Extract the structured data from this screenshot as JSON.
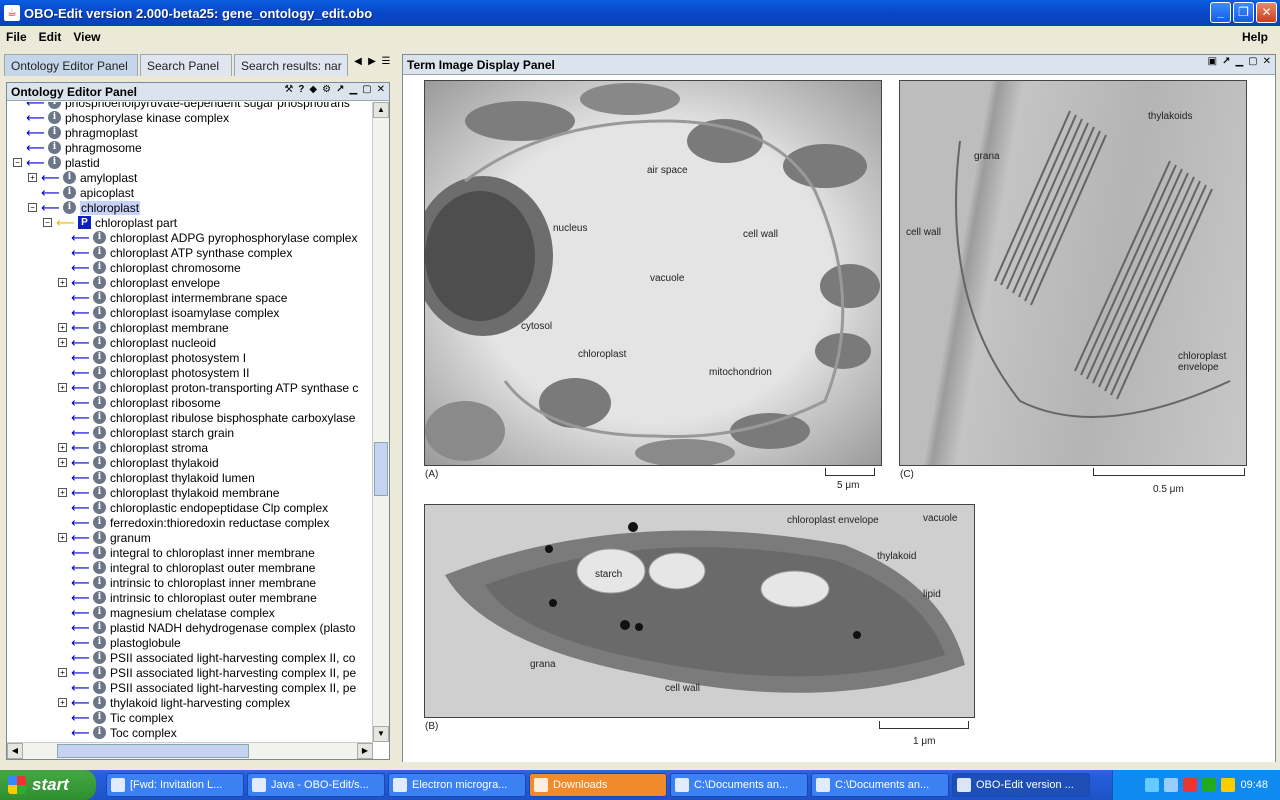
{
  "window": {
    "title": "OBO-Edit version 2.000-beta25: gene_ontology_edit.obo"
  },
  "menu": {
    "file": "File",
    "edit": "Edit",
    "view": "View",
    "help": "Help"
  },
  "left_tabs": [
    "Ontology Editor Panel",
    "Search Panel",
    "Search results: nar"
  ],
  "ontology_panel": {
    "title": "Ontology Editor Panel",
    "tree": [
      {
        "label": "phosphoenolpyruvate-dependent sugar phosphotrans",
        "depth": 1,
        "expander": "",
        "rel": "is_a",
        "badge": "i"
      },
      {
        "label": "phosphorylase kinase complex",
        "depth": 1,
        "expander": "",
        "rel": "is_a",
        "badge": "i"
      },
      {
        "label": "phragmoplast",
        "depth": 1,
        "expander": "",
        "rel": "is_a",
        "badge": "i"
      },
      {
        "label": "phragmosome",
        "depth": 1,
        "expander": "",
        "rel": "is_a",
        "badge": "i"
      },
      {
        "label": "plastid",
        "depth": 1,
        "expander": "−",
        "rel": "is_a",
        "badge": "i"
      },
      {
        "label": "amyloplast",
        "depth": 2,
        "expander": "+",
        "rel": "is_a",
        "badge": "i"
      },
      {
        "label": "apicoplast",
        "depth": 2,
        "expander": "",
        "rel": "is_a",
        "badge": "i"
      },
      {
        "label": "chloroplast",
        "depth": 2,
        "expander": "−",
        "rel": "is_a",
        "badge": "i",
        "selected": true
      },
      {
        "label": "chloroplast part",
        "depth": 3,
        "expander": "−",
        "rel": "part_of",
        "badge": "P"
      },
      {
        "label": "chloroplast ADPG pyrophosphorylase complex",
        "depth": 4,
        "expander": "",
        "rel": "is_a",
        "badge": "i"
      },
      {
        "label": "chloroplast ATP synthase complex",
        "depth": 4,
        "expander": "",
        "rel": "is_a",
        "badge": "i"
      },
      {
        "label": "chloroplast chromosome",
        "depth": 4,
        "expander": "",
        "rel": "is_a",
        "badge": "i"
      },
      {
        "label": "chloroplast envelope",
        "depth": 4,
        "expander": "+",
        "rel": "is_a",
        "badge": "i"
      },
      {
        "label": "chloroplast intermembrane space",
        "depth": 4,
        "expander": "",
        "rel": "is_a",
        "badge": "i"
      },
      {
        "label": "chloroplast isoamylase complex",
        "depth": 4,
        "expander": "",
        "rel": "is_a",
        "badge": "i"
      },
      {
        "label": "chloroplast membrane",
        "depth": 4,
        "expander": "+",
        "rel": "is_a",
        "badge": "i"
      },
      {
        "label": "chloroplast nucleoid",
        "depth": 4,
        "expander": "+",
        "rel": "is_a",
        "badge": "i"
      },
      {
        "label": "chloroplast photosystem I",
        "depth": 4,
        "expander": "",
        "rel": "is_a",
        "badge": "i"
      },
      {
        "label": "chloroplast photosystem II",
        "depth": 4,
        "expander": "",
        "rel": "is_a",
        "badge": "i"
      },
      {
        "label": "chloroplast proton-transporting ATP synthase c",
        "depth": 4,
        "expander": "+",
        "rel": "is_a",
        "badge": "i"
      },
      {
        "label": "chloroplast ribosome",
        "depth": 4,
        "expander": "",
        "rel": "is_a",
        "badge": "i"
      },
      {
        "label": "chloroplast ribulose bisphosphate carboxylase",
        "depth": 4,
        "expander": "",
        "rel": "is_a",
        "badge": "i"
      },
      {
        "label": "chloroplast starch grain",
        "depth": 4,
        "expander": "",
        "rel": "is_a",
        "badge": "i"
      },
      {
        "label": "chloroplast stroma",
        "depth": 4,
        "expander": "+",
        "rel": "is_a",
        "badge": "i"
      },
      {
        "label": "chloroplast thylakoid",
        "depth": 4,
        "expander": "+",
        "rel": "is_a",
        "badge": "i"
      },
      {
        "label": "chloroplast thylakoid lumen",
        "depth": 4,
        "expander": "",
        "rel": "is_a",
        "badge": "i"
      },
      {
        "label": "chloroplast thylakoid membrane",
        "depth": 4,
        "expander": "+",
        "rel": "is_a",
        "badge": "i"
      },
      {
        "label": "chloroplastic endopeptidase Clp complex",
        "depth": 4,
        "expander": "",
        "rel": "is_a",
        "badge": "i"
      },
      {
        "label": "ferredoxin:thioredoxin reductase complex",
        "depth": 4,
        "expander": "",
        "rel": "is_a",
        "badge": "i"
      },
      {
        "label": "granum",
        "depth": 4,
        "expander": "+",
        "rel": "is_a",
        "badge": "i"
      },
      {
        "label": "integral to chloroplast inner membrane",
        "depth": 4,
        "expander": "",
        "rel": "is_a",
        "badge": "i"
      },
      {
        "label": "integral to chloroplast outer membrane",
        "depth": 4,
        "expander": "",
        "rel": "is_a",
        "badge": "i"
      },
      {
        "label": "intrinsic to chloroplast inner membrane",
        "depth": 4,
        "expander": "",
        "rel": "is_a",
        "badge": "i"
      },
      {
        "label": "intrinsic to chloroplast outer membrane",
        "depth": 4,
        "expander": "",
        "rel": "is_a",
        "badge": "i"
      },
      {
        "label": "magnesium chelatase complex",
        "depth": 4,
        "expander": "",
        "rel": "is_a",
        "badge": "i"
      },
      {
        "label": "plastid NADH dehydrogenase complex (plasto",
        "depth": 4,
        "expander": "",
        "rel": "is_a",
        "badge": "i"
      },
      {
        "label": "plastoglobule",
        "depth": 4,
        "expander": "",
        "rel": "is_a",
        "badge": "i"
      },
      {
        "label": "PSII associated light-harvesting complex II, co",
        "depth": 4,
        "expander": "",
        "rel": "is_a",
        "badge": "i"
      },
      {
        "label": "PSII associated light-harvesting complex II, pe",
        "depth": 4,
        "expander": "+",
        "rel": "is_a",
        "badge": "i"
      },
      {
        "label": "PSII associated light-harvesting complex II, pe",
        "depth": 4,
        "expander": "",
        "rel": "is_a",
        "badge": "i"
      },
      {
        "label": "thylakoid light-harvesting complex",
        "depth": 4,
        "expander": "+",
        "rel": "is_a",
        "badge": "i"
      },
      {
        "label": "Tic complex",
        "depth": 4,
        "expander": "",
        "rel": "is_a",
        "badge": "i"
      },
      {
        "label": "Toc complex",
        "depth": 4,
        "expander": "",
        "rel": "is_a",
        "badge": "i"
      }
    ]
  },
  "image_panel": {
    "title": "Term Image Display Panel",
    "panel_a": {
      "tag": "(A)",
      "scale": "5 μm",
      "labels": [
        "air space",
        "nucleus",
        "cell wall",
        "vacuole",
        "cytosol",
        "chloroplast",
        "mitochondrion"
      ]
    },
    "panel_b": {
      "tag": "(B)",
      "scale": "1 μm",
      "labels": [
        "chloroplast envelope",
        "vacuole",
        "thylakoid",
        "starch",
        "lipid",
        "grana",
        "cell wall"
      ]
    },
    "panel_c": {
      "tag": "(C)",
      "scale": "0.5 μm",
      "labels": [
        "thylakoids",
        "grana",
        "cell wall",
        "chloroplast envelope"
      ]
    }
  },
  "taskbar": {
    "start": "start",
    "items": [
      "[Fwd: Invitation L...",
      "Java - OBO-Edit/s...",
      "Electron microgra...",
      "Downloads",
      "C:\\Documents an...",
      "C:\\Documents an...",
      "OBO-Edit version ..."
    ],
    "clock": "09:48"
  }
}
